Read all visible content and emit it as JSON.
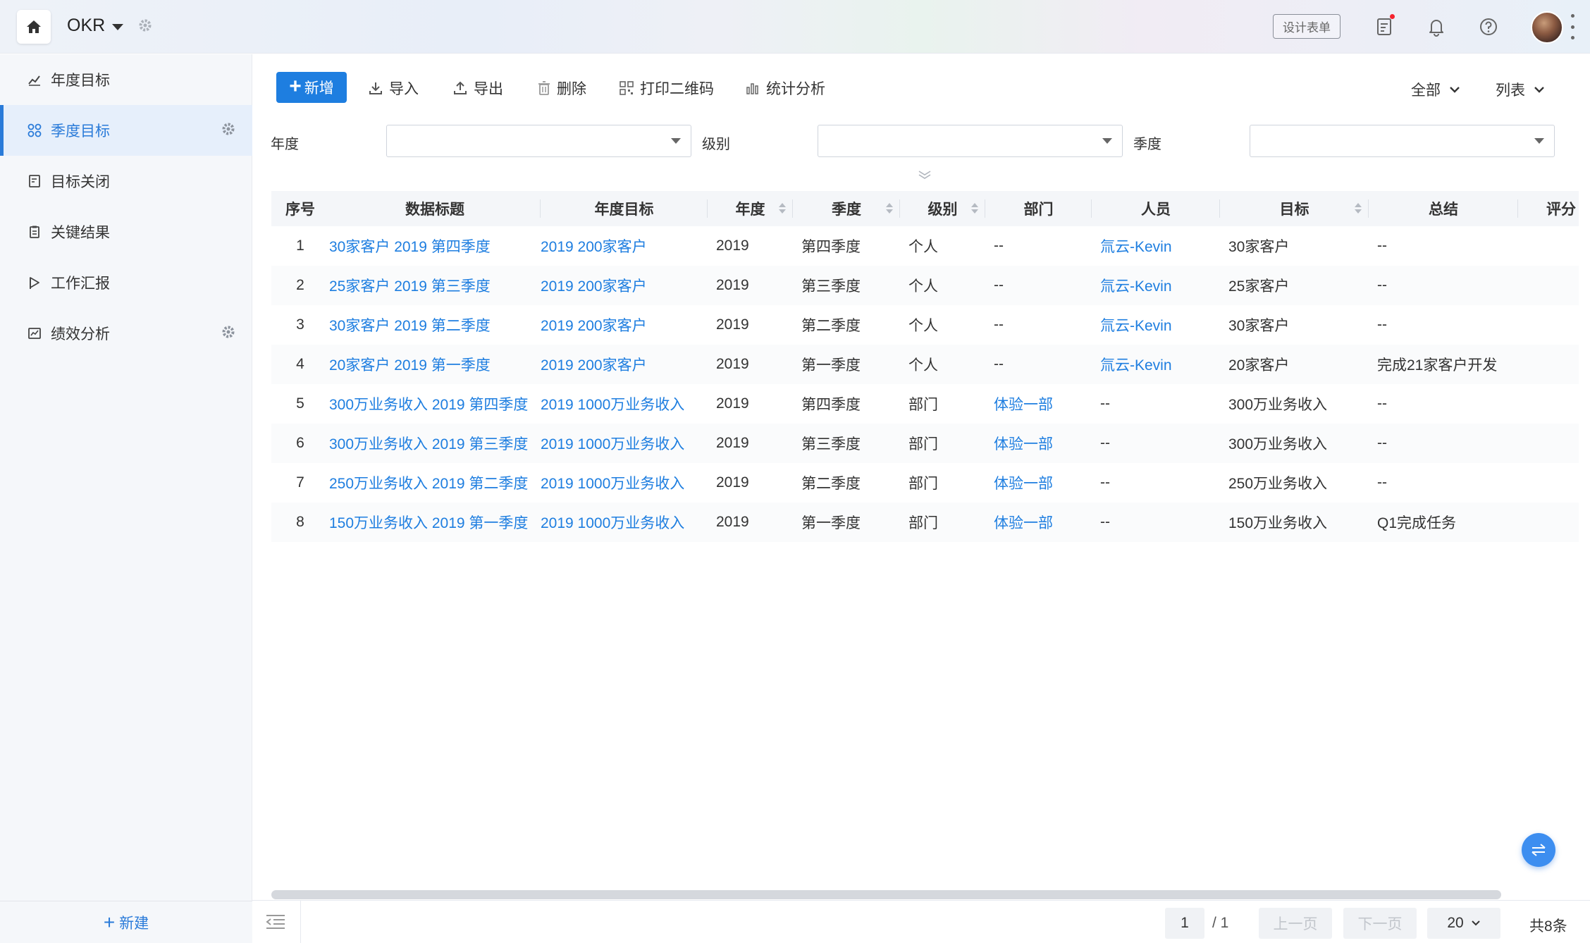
{
  "app": {
    "title": "OKR"
  },
  "topbar": {
    "design_form_label": "设计表单"
  },
  "sidebar": {
    "items": [
      {
        "label": "年度目标",
        "icon": "trend-chart-icon"
      },
      {
        "label": "季度目标",
        "icon": "grid-nodes-icon",
        "active": true
      },
      {
        "label": "目标关闭",
        "icon": "doc-close-icon"
      },
      {
        "label": "关键结果",
        "icon": "clipboard-icon"
      },
      {
        "label": "工作汇报",
        "icon": "report-flag-icon"
      },
      {
        "label": "绩效分析",
        "icon": "line-chart-icon"
      }
    ],
    "new_label": "新建"
  },
  "toolbar": {
    "new_label": "新增",
    "import_label": "导入",
    "export_label": "导出",
    "delete_label": "删除",
    "print_qr_label": "打印二维码",
    "stats_label": "统计分析",
    "scope_label": "全部",
    "view_label": "列表"
  },
  "filters": {
    "year_label": "年度",
    "level_label": "级别",
    "quarter_label": "季度"
  },
  "table": {
    "columns": [
      "序号",
      "数据标题",
      "年度目标",
      "年度",
      "季度",
      "级别",
      "部门",
      "人员",
      "目标",
      "总结",
      "评分"
    ],
    "rows": [
      [
        "1",
        "30家客户 2019 第四季度",
        "2019 200家客户",
        "2019",
        "第四季度",
        "个人",
        "--",
        "氚云-Kevin",
        "30家客户",
        "--"
      ],
      [
        "2",
        "25家客户 2019 第三季度",
        "2019 200家客户",
        "2019",
        "第三季度",
        "个人",
        "--",
        "氚云-Kevin",
        "25家客户",
        "--"
      ],
      [
        "3",
        "30家客户 2019 第二季度",
        "2019 200家客户",
        "2019",
        "第二季度",
        "个人",
        "--",
        "氚云-Kevin",
        "30家客户",
        "--"
      ],
      [
        "4",
        "20家客户 2019 第一季度",
        "2019 200家客户",
        "2019",
        "第一季度",
        "个人",
        "--",
        "氚云-Kevin",
        "20家客户",
        "完成21家客户开发"
      ],
      [
        "5",
        "300万业务收入 2019 第四季度",
        "2019 1000万业务收入",
        "2019",
        "第四季度",
        "部门",
        "体验一部",
        "--",
        "300万业务收入",
        "--"
      ],
      [
        "6",
        "300万业务收入 2019 第三季度",
        "2019 1000万业务收入",
        "2019",
        "第三季度",
        "部门",
        "体验一部",
        "--",
        "300万业务收入",
        "--"
      ],
      [
        "7",
        "250万业务收入 2019 第二季度",
        "2019 1000万业务收入",
        "2019",
        "第二季度",
        "部门",
        "体验一部",
        "--",
        "250万业务收入",
        "--"
      ],
      [
        "8",
        "150万业务收入 2019 第一季度",
        "2019 1000万业务收入",
        "2019",
        "第一季度",
        "部门",
        "体验一部",
        "--",
        "150万业务收入",
        "Q1完成任务"
      ]
    ]
  },
  "pager": {
    "current_page": "1",
    "total_pages": "/ 1",
    "prev_label": "上一页",
    "next_label": "下一页",
    "page_size": "20",
    "total_count": "共8条"
  },
  "colors": {
    "accent": "#1e7ee0",
    "sidebar_bg": "#f5f7fa",
    "active_bg": "#e6effb"
  }
}
